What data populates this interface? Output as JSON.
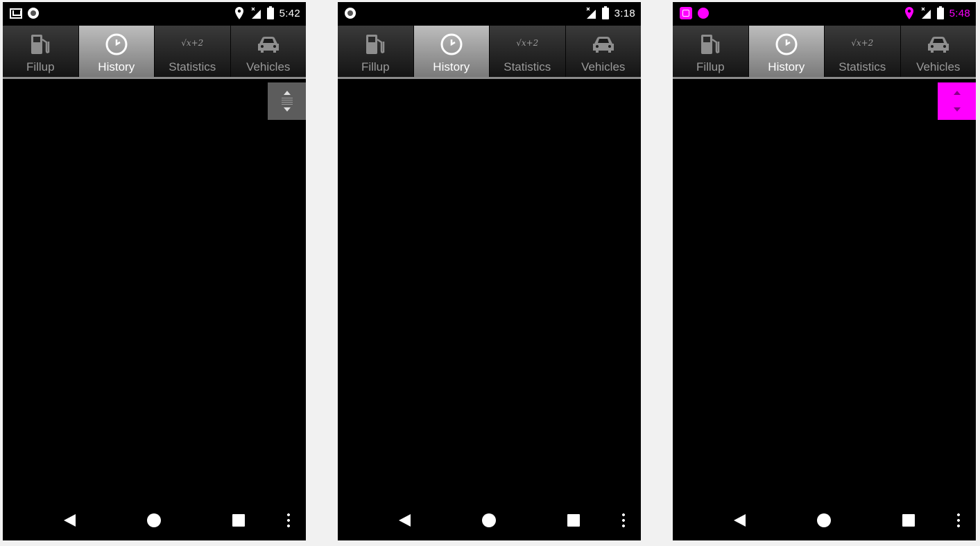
{
  "colors": {
    "highlight": "#ff00ff",
    "screen_background": "#000000",
    "selected_tab": "#a0a0a0",
    "tab_text": "#9a9a9a"
  },
  "phones": [
    {
      "status": {
        "time": "5:42",
        "left_icons": [
          "gmail-icon",
          "record-icon"
        ],
        "right_icons": [
          "location-icon",
          "no-signal-icon",
          "battery-icon"
        ]
      },
      "tabs": [
        {
          "label": "Fillup",
          "icon": "fuel-pump-icon",
          "selected": false
        },
        {
          "label": "History",
          "icon": "clock-icon",
          "selected": true
        },
        {
          "label": "Statistics",
          "icon": "sqrt-formula-icon",
          "glyph": "√x+2",
          "selected": false
        },
        {
          "label": "Vehicles",
          "icon": "car-icon",
          "selected": false
        }
      ]
    },
    {
      "status": {
        "time": "3:18",
        "left_icons": [
          "record-icon"
        ],
        "right_icons": [
          "no-signal-icon",
          "battery-icon"
        ]
      },
      "tabs": [
        {
          "label": "Fillup",
          "icon": "fuel-pump-icon",
          "selected": false
        },
        {
          "label": "History",
          "icon": "clock-icon",
          "selected": true
        },
        {
          "label": "Statistics",
          "icon": "sqrt-formula-icon",
          "glyph": "√x+2",
          "selected": false
        },
        {
          "label": "Vehicles",
          "icon": "car-icon",
          "selected": false
        }
      ]
    },
    {
      "status": {
        "time": "5:48",
        "left_icons": [
          "screenshot-icon",
          "record-icon"
        ],
        "right_icons": [
          "location-icon",
          "no-signal-icon",
          "battery-icon"
        ]
      },
      "tabs": [
        {
          "label": "Fillup",
          "icon": "fuel-pump-icon",
          "selected": false
        },
        {
          "label": "History",
          "icon": "clock-icon",
          "selected": true
        },
        {
          "label": "Statistics",
          "icon": "sqrt-formula-icon",
          "glyph": "√x+2",
          "selected": false
        },
        {
          "label": "Vehicles",
          "icon": "car-icon",
          "selected": false
        }
      ]
    }
  ]
}
